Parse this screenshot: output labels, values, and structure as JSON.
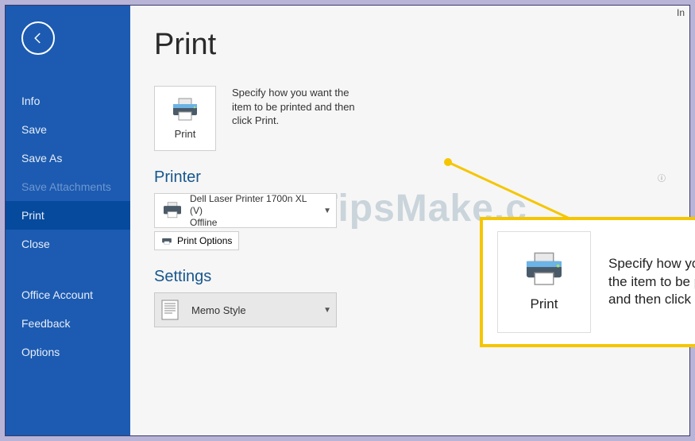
{
  "topRight": "In",
  "sidebar": {
    "items": [
      {
        "label": "Info",
        "selected": false,
        "disabled": false
      },
      {
        "label": "Save",
        "selected": false,
        "disabled": false
      },
      {
        "label": "Save As",
        "selected": false,
        "disabled": false
      },
      {
        "label": "Save Attachments",
        "selected": false,
        "disabled": true
      },
      {
        "label": "Print",
        "selected": true,
        "disabled": false
      },
      {
        "label": "Close",
        "selected": false,
        "disabled": false
      }
    ],
    "footerItems": [
      {
        "label": "Office Account"
      },
      {
        "label": "Feedback"
      },
      {
        "label": "Options"
      }
    ]
  },
  "page": {
    "title": "Print",
    "printButton": "Print",
    "description": "Specify how you want the item to be printed and then click Print.",
    "printerSection": "Printer",
    "printerName": "Dell Laser Printer 1700n XL (V)",
    "printerStatus": "Offline",
    "printOptions": "Print Options",
    "settingsSection": "Settings",
    "styleName": "Memo Style"
  },
  "callout": {
    "buttonLabel": "Print",
    "text": "Specify how you want the item to be printed and then click Print."
  },
  "watermark": "TipsMake.c"
}
